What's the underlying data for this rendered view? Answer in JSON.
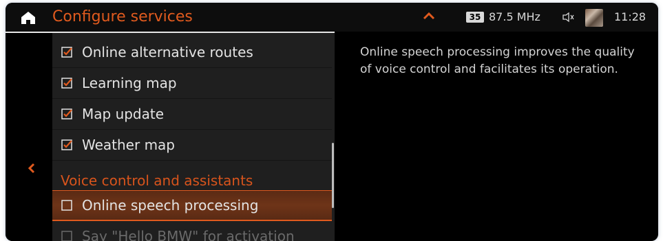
{
  "header": {
    "title": "Configure services",
    "station_preset": "35",
    "frequency": "87.5 MHz",
    "time": "11:28"
  },
  "icons": {
    "home": "home-icon",
    "expand": "chevron-up-icon",
    "mute": "speaker-muted-icon",
    "cover": "album-cover-icon",
    "back": "chevron-left-icon",
    "checked": "checkbox-checked-icon",
    "unchecked": "checkbox-unchecked-icon"
  },
  "colors": {
    "accent": "#e05a1e",
    "text": "#e4e4e4",
    "panel": "#1f1f1f",
    "background": "#000000"
  },
  "list": {
    "items": [
      {
        "label": "Online alternative routes",
        "checked": true
      },
      {
        "label": "Learning map",
        "checked": true
      },
      {
        "label": "Map update",
        "checked": true
      },
      {
        "label": "Weather map",
        "checked": true
      }
    ],
    "section_title": "Voice control and assistants",
    "section_items": [
      {
        "label": "Online speech processing",
        "checked": false,
        "selected": true
      },
      {
        "label": "Say \"Hello BMW\" for activation",
        "checked": false,
        "disabled": true
      }
    ]
  },
  "detail": {
    "description": "Online speech processing improves the quality of voice control and facilitates its operation."
  }
}
